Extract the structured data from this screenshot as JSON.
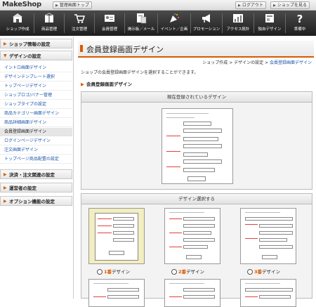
{
  "app": {
    "logo": "MakeShop"
  },
  "topbar": {
    "admin_top": "管理画面トップ",
    "logout": "ログアウト",
    "back_to_shop": "ショップを見る"
  },
  "nav": [
    {
      "label": "ショップ作成",
      "icon": "shop-icon"
    },
    {
      "label": "商品管理",
      "icon": "package-icon"
    },
    {
      "label": "注文管理",
      "icon": "cart-icon"
    },
    {
      "label": "会員管理",
      "icon": "member-card-icon"
    },
    {
      "label": "掲示板／メール",
      "icon": "bulletin-icon"
    },
    {
      "label": "イベント／企画",
      "icon": "party-icon"
    },
    {
      "label": "プロモーション",
      "icon": "promotion-icon"
    },
    {
      "label": "アクセス統計",
      "icon": "stats-icon"
    },
    {
      "label": "独自デザイン",
      "icon": "design-icon"
    },
    {
      "label": "準備中",
      "icon": "question-icon"
    }
  ],
  "sidebar": {
    "sections": [
      {
        "title": "ショップ情報の設定"
      },
      {
        "title": "デザインの設定"
      },
      {
        "title": "決済・注文関連の設定"
      },
      {
        "title": "運営者の設定"
      },
      {
        "title": "オプション機能の設定"
      }
    ],
    "design_items": [
      "イントロ画面デザイン",
      "デザインテンプレート選択",
      "トップページデザイン",
      "ショップロゴ/バナー管理",
      "ショップタイプの設定",
      "商品カテゴリー画面デザイン",
      "商品詳細画面デザイン",
      "会員登録画面デザイン",
      "ログインページデザイン",
      "注文画面デザイン",
      "トップページ商品配置の設定"
    ]
  },
  "main": {
    "title": "会員登録画面デザイン",
    "breadcrumb": {
      "a": "ショップ作成",
      "sep": " > ",
      "b": "デザインの設定",
      "c": "会員登録画面デザイン"
    },
    "description": "ショップの会員登録画面デザインを選択することができます。",
    "section_title": "会員登録画面デザイン",
    "current_panel_title": "現在登録されているデザイン",
    "select_panel_title": "デザイン選択する",
    "choices": [
      {
        "num": "1番",
        "suffix": "デザイン"
      },
      {
        "num": "2番",
        "suffix": "デザイン"
      },
      {
        "num": "3番",
        "suffix": "デザイン"
      }
    ]
  },
  "colors": {
    "accent": "#d85a00",
    "link": "#1a55a8",
    "nav_bg": "#2b2b2b"
  }
}
